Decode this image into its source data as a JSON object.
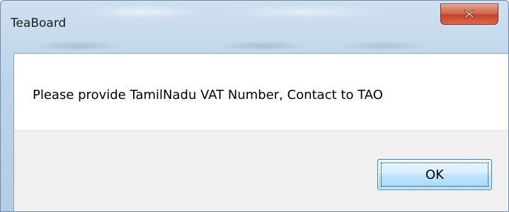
{
  "window": {
    "title": "TeaBoard"
  },
  "titlebar": {
    "close_icon": "close-icon"
  },
  "dialog": {
    "message": "Please provide TamilNadu VAT Number, Contact to TAO",
    "ok_label": "OK"
  },
  "colors": {
    "close_button": "#c4442a",
    "ok_button_border": "#3c7fb1",
    "client_background": "#ffffff",
    "footer_background": "#f0f0f0"
  }
}
